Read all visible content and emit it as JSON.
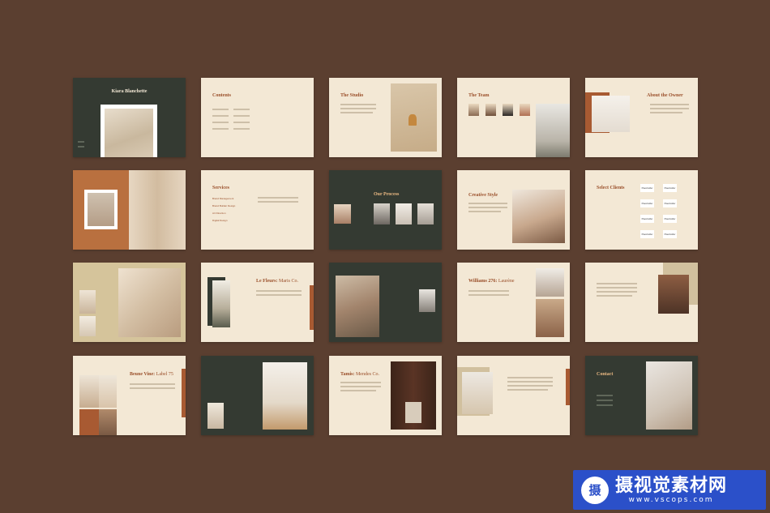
{
  "slides": {
    "s1": {
      "title": "Kiara Blanchette"
    },
    "s2": {
      "title": "Contents"
    },
    "s3": {
      "title": "The Studio"
    },
    "s4": {
      "title": "The Team"
    },
    "s5": {
      "title": "About the Owner"
    },
    "s7": {
      "title": "Services",
      "items": [
        "Brand Management",
        "Brand Builder Design",
        "Art Direction",
        "Digital Design"
      ]
    },
    "s8": {
      "title": "Our Process"
    },
    "s9": {
      "title": "Creative Style"
    },
    "s10": {
      "title": "Select Clients",
      "logo_label": "Placeholder"
    },
    "s12": {
      "title_bold": "Le Fleurs:",
      "title_light": "Maris Co."
    },
    "s14": {
      "title_bold": "Williams 276:",
      "title_light": "Laurène"
    },
    "s16": {
      "title_bold": "Beune Vine:",
      "title_light": "Label 75"
    },
    "s18": {
      "title_bold": "Tamis:",
      "title_light": "Mendes Co."
    },
    "s20": {
      "title": "Contact"
    }
  },
  "watermark": {
    "logo_char": "摄",
    "name": "摄视觉素材网",
    "url": "www.vscops.com"
  },
  "colors": {
    "background": "#5b3f30",
    "cream": "#f3e8d5",
    "dark_green": "#343a32",
    "rust": "#a85a32",
    "watermark_blue": "#2b50c9"
  }
}
